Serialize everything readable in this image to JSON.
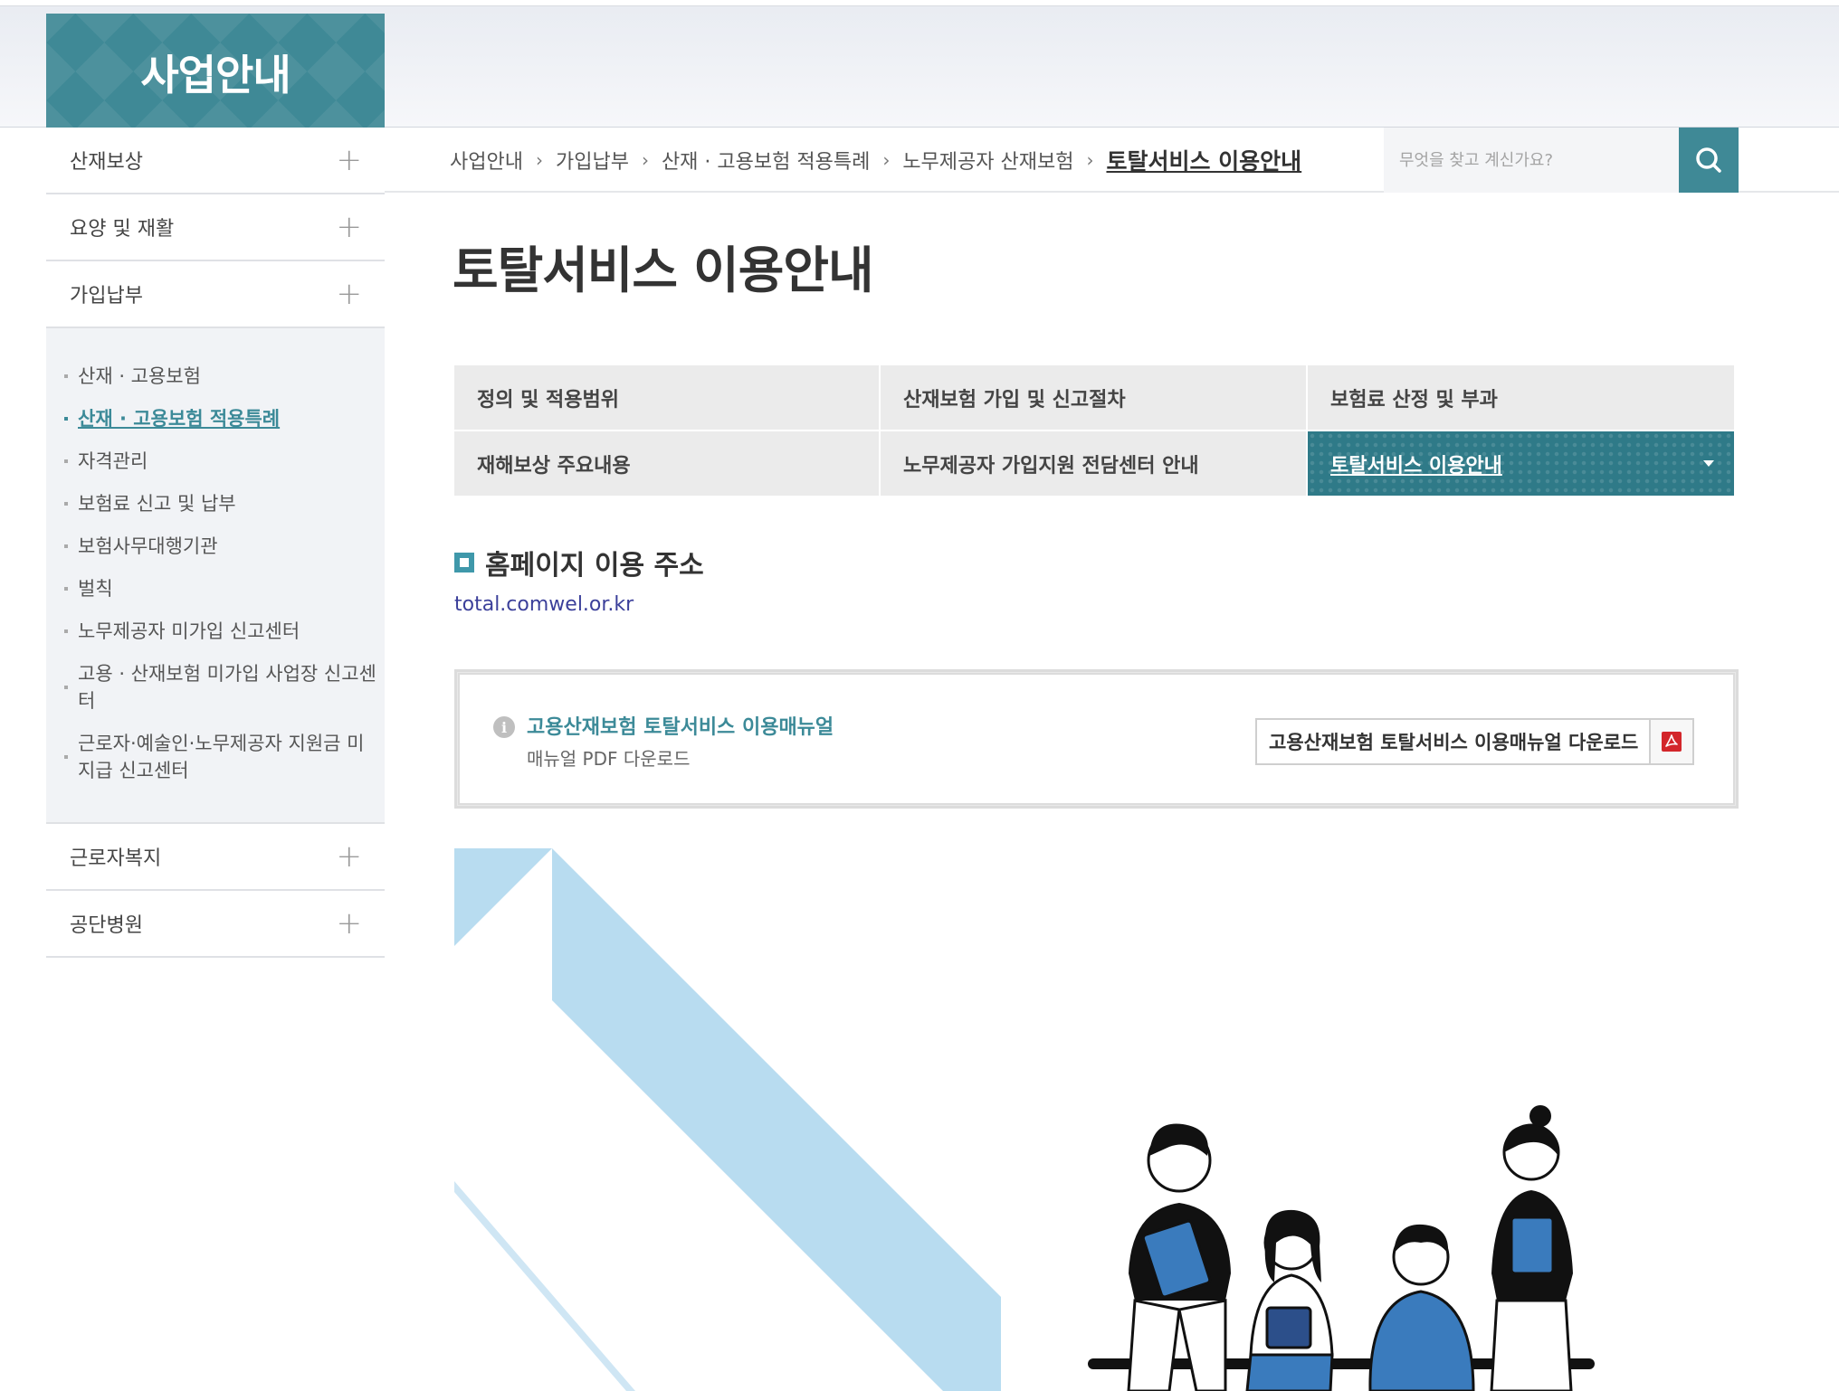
{
  "section": {
    "title": "사업안내"
  },
  "lnb": {
    "items_top": [
      {
        "label": "산재보상"
      },
      {
        "label": "요양 및 재활"
      },
      {
        "label": "가입납부"
      }
    ],
    "sub_items": [
      {
        "label": "산재 · 고용보험"
      },
      {
        "label": "산재 · 고용보험 적용특례"
      },
      {
        "label": "자격관리"
      },
      {
        "label": "보험료 신고 및 납부"
      },
      {
        "label": "보험사무대행기관"
      },
      {
        "label": "벌칙"
      },
      {
        "label": "노무제공자 미가입 신고센터"
      },
      {
        "label": "고용 · 산재보험 미가입 사업장 신고센터"
      },
      {
        "label": "근로자·예술인·노무제공자 지원금 미지급 신고센터"
      }
    ],
    "items_bottom": [
      {
        "label": "근로자복지"
      },
      {
        "label": "공단병원"
      }
    ],
    "plus_glyph": "+"
  },
  "breadcrumb": {
    "items": [
      "사업안내",
      "가입납부",
      "산재 · 고용보험 적용특례",
      "노무제공자 산재보험"
    ],
    "current": "토탈서비스 이용안내",
    "separator": "›"
  },
  "search": {
    "placeholder": "무엇을 찾고 계신가요?",
    "icon": "search-icon"
  },
  "page": {
    "title": "토탈서비스 이용안내"
  },
  "tabs": [
    {
      "label": "정의 및 적용범위"
    },
    {
      "label": "산재보험 가입 및 신고절차"
    },
    {
      "label": "보험료 산정 및 부과"
    },
    {
      "label": "재해보상 주요내용"
    },
    {
      "label": "노무제공자 가입지원 전담센터 안내"
    },
    {
      "label": "토탈서비스 이용안내"
    }
  ],
  "homepage": {
    "heading": "홈페이지 이용 주소",
    "url": "total.comwel.or.kr"
  },
  "manual": {
    "info_glyph": "i",
    "title": "고용산재보험 토탈서비스 이용매뉴얼",
    "subtitle": "매뉴얼 PDF 다운로드",
    "download_label": "고용산재보험 토탈서비스 이용매뉴얼 다운로드",
    "download_icon": "pdf-icon"
  },
  "colors": {
    "accent": "#3f8996",
    "active_tab": "#2f7a88",
    "link": "#3b3f9a",
    "illustration_blue": "#b8dcf0"
  }
}
